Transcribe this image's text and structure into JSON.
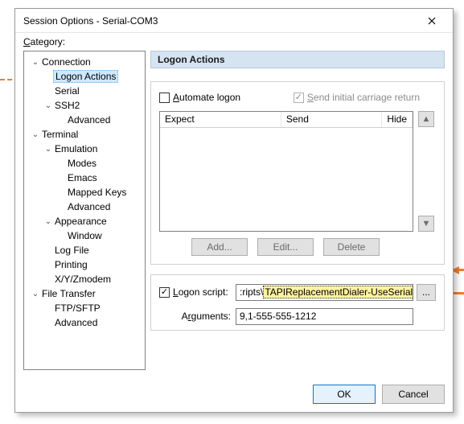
{
  "window": {
    "title": "Session Options - Serial-COM3"
  },
  "category_label": "Category:",
  "tree": [
    {
      "label": "Connection",
      "depth": 0,
      "expanded": true
    },
    {
      "label": "Logon Actions",
      "depth": 1,
      "selected": true
    },
    {
      "label": "Serial",
      "depth": 1
    },
    {
      "label": "SSH2",
      "depth": 1,
      "expanded": true
    },
    {
      "label": "Advanced",
      "depth": 2
    },
    {
      "label": "Terminal",
      "depth": 0,
      "expanded": true
    },
    {
      "label": "Emulation",
      "depth": 1,
      "expanded": true
    },
    {
      "label": "Modes",
      "depth": 2
    },
    {
      "label": "Emacs",
      "depth": 2
    },
    {
      "label": "Mapped Keys",
      "depth": 2
    },
    {
      "label": "Advanced",
      "depth": 2
    },
    {
      "label": "Appearance",
      "depth": 1,
      "expanded": true
    },
    {
      "label": "Window",
      "depth": 2
    },
    {
      "label": "Log File",
      "depth": 1
    },
    {
      "label": "Printing",
      "depth": 1
    },
    {
      "label": "X/Y/Zmodem",
      "depth": 1
    },
    {
      "label": "File Transfer",
      "depth": 0,
      "expanded": true
    },
    {
      "label": "FTP/SFTP",
      "depth": 1
    },
    {
      "label": "Advanced",
      "depth": 1
    }
  ],
  "header": {
    "title": "Logon Actions"
  },
  "automate": {
    "automate_label": "Automate logon",
    "send_icr_label": "Send initial carriage return",
    "columns": {
      "expect": "Expect",
      "send": "Send",
      "hide": "Hide"
    },
    "buttons": {
      "add": "Add...",
      "edit": "Edit...",
      "delete": "Delete"
    }
  },
  "script": {
    "logon_label": "Logon script:",
    "logon_value_prefix": ":ripts\\",
    "logon_value_sel": "TAPIReplacementDialer-UseSerial.vbs",
    "browse_label": "...",
    "args_label": "Arguments:",
    "args_value": "9,1-555-555-1212"
  },
  "buttons": {
    "ok": "OK",
    "cancel": "Cancel"
  }
}
